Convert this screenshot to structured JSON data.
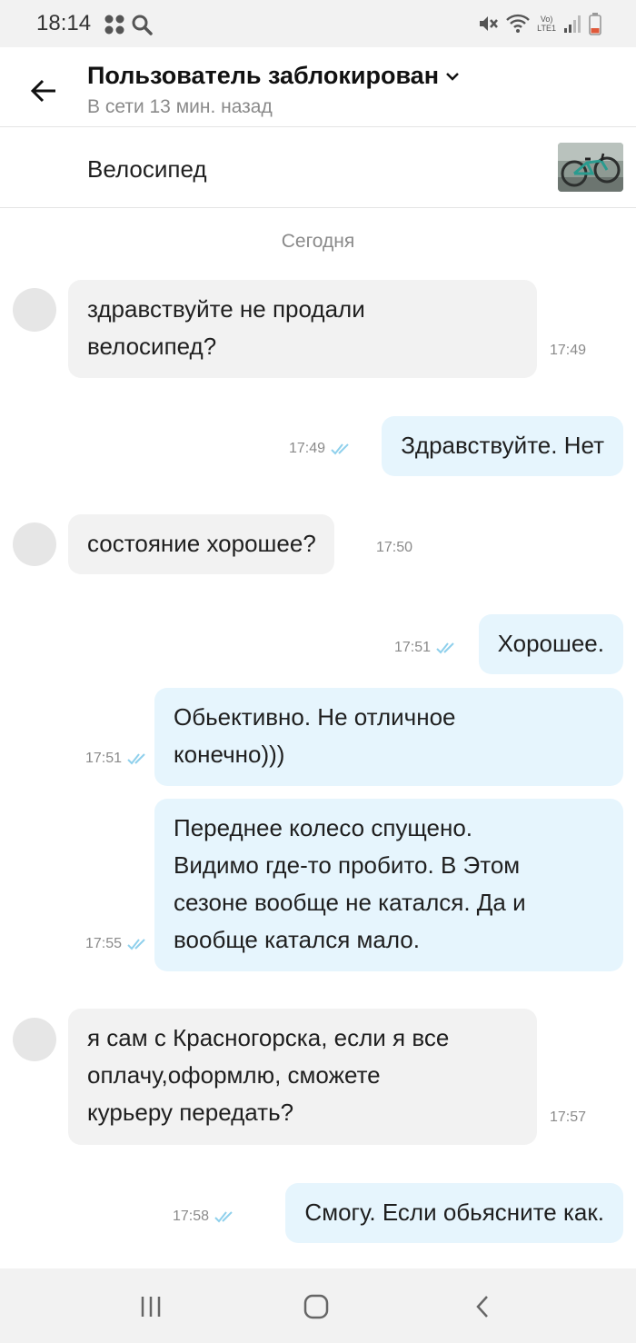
{
  "status_bar": {
    "time": "18:14",
    "network_top": "Vo)",
    "network_bottom": "LTE1"
  },
  "header": {
    "title": "Пользователь заблокирован",
    "subtitle": "В сети 13 мин. назад"
  },
  "item": {
    "title": "Велосипед"
  },
  "chat": {
    "date_separator": "Сегодня",
    "messages": [
      {
        "direction": "in",
        "lines": [
          "здравствуйте не продали",
          "велосипед?"
        ],
        "time": "17:49"
      },
      {
        "direction": "out",
        "lines": [
          "Здравствуйте. Нет"
        ],
        "time": "17:49"
      },
      {
        "direction": "in",
        "lines": [
          "состояние хорошее?"
        ],
        "time": "17:50"
      },
      {
        "direction": "out",
        "lines": [
          "Хорошее."
        ],
        "time": "17:51"
      },
      {
        "direction": "out",
        "lines": [
          "Обьективно. Не отличное",
          "конечно)))"
        ],
        "time": "17:51"
      },
      {
        "direction": "out",
        "lines": [
          "Переднее колесо спущено.",
          "Видимо где-то пробито. В Этом",
          "сезоне вообще не катался. Да и",
          "вообще катался мало."
        ],
        "time": "17:55"
      },
      {
        "direction": "in",
        "lines": [
          "я сам с Красногорска, если я все",
          "оплачу,оформлю, сможете",
          "курьеру передать?"
        ],
        "time": "17:57"
      },
      {
        "direction": "out",
        "lines": [
          "Смогу. Если обьясните как."
        ],
        "time": "17:58"
      }
    ]
  },
  "colors": {
    "incoming_bubble": "#f2f2f2",
    "outgoing_bubble": "#e6f5fd",
    "read_check": "#8fd0ec",
    "muted_text": "#8a8a8a"
  },
  "icons": {
    "back": "arrow-left-icon",
    "title_dropdown": "chevron-down-icon",
    "read_receipt": "double-check-icon",
    "nav_recents": "recents-icon",
    "nav_home": "home-icon",
    "nav_back": "nav-back-icon"
  }
}
